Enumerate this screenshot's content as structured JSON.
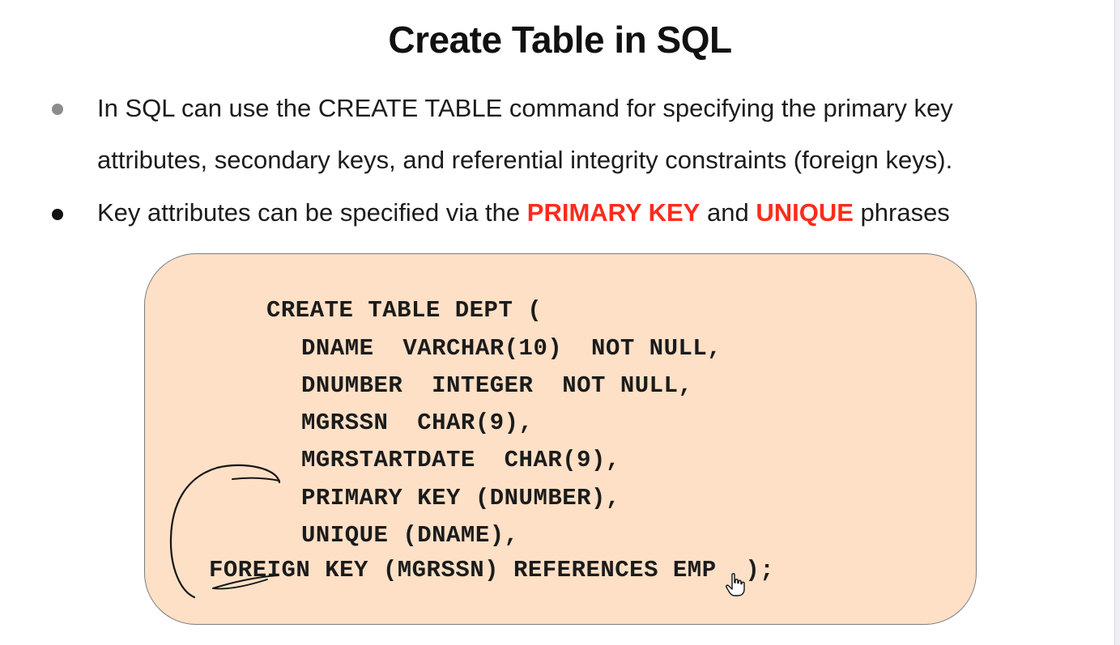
{
  "slide": {
    "title": "Create Table in SQL",
    "bullets": [
      {
        "line1": "In SQL can use the CREATE TABLE command for specifying the primary key",
        "line2": "attributes, secondary keys, and referential integrity constraints (foreign keys)."
      },
      {
        "prefix": "Key attributes can be specified via the ",
        "keyword1": "PRIMARY KEY",
        "middle": " and ",
        "keyword2": "UNIQUE",
        "suffix": " phrases"
      }
    ],
    "code": [
      "CREATE TABLE DEPT (",
      "DNAME  VARCHAR(10)  NOT NULL,",
      "DNUMBER  INTEGER  NOT NULL,",
      "MGRSSN  CHAR(9),",
      "MGRSTARTDATE  CHAR(9),",
      "PRIMARY KEY (DNUMBER),",
      "UNIQUE (DNAME),",
      "FOREIGN KEY (MGRSSN) REFERENCES EMP  );"
    ]
  },
  "colors": {
    "keyword": "#ff2b1c",
    "code_background": "#fde0c6",
    "bullet_first": "#8c8c8c",
    "bullet_second": "#111111"
  },
  "icons": {
    "cursor": "hand-pointer-icon",
    "annotation": "handwritten-bracket-annotation"
  }
}
